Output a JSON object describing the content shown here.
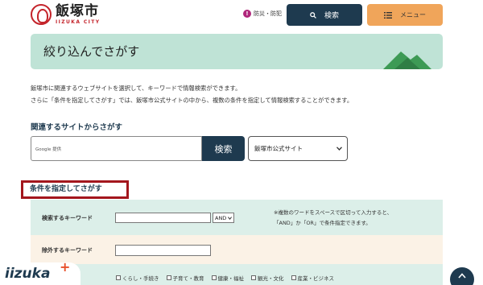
{
  "header": {
    "logo_title": "飯塚市",
    "logo_sub": "IIZUKA CITY",
    "disaster_icon": "!",
    "disaster_label": "防災・防犯",
    "search_icon": "search-icon",
    "search_label": "検索",
    "menu_icon": "hamburger-icon",
    "menu_label": "メニュー"
  },
  "banner": {
    "title": "絞り込んでさがす"
  },
  "description": {
    "line1": "飯塚市に関連するウェブサイトを選択して、キーワードで情報検索ができます。",
    "line2": "さらに「条件を指定してさがす」では、飯塚市公式サイトの中から、複数の条件を指定して情報検索することができます。"
  },
  "related": {
    "heading": "関連するサイトからさがす",
    "google_placeholder": "Google 提供",
    "search_button": "検索",
    "site_select_value": "飯塚市公式サイト"
  },
  "conditions": {
    "heading": "条件を指定してさがす",
    "keyword_label": "検索するキーワード",
    "keyword_value": "",
    "operator_value": "AND",
    "note_line1": "※複数のワードをスペースで区切って入力すると、",
    "note_line2": "「AND」か「OR」で条件指定できます。",
    "exclude_label": "除外するキーワード",
    "exclude_value": "",
    "categories": [
      "くらし・手続き",
      "子育て・教育",
      "健康・福祉",
      "観光・文化",
      "産業・ビジネス"
    ]
  },
  "footer": {
    "brand": "iizuka",
    "plus": "+",
    "top_icon": "chevron-up-icon"
  },
  "colors": {
    "navy": "#1e3a4f",
    "orange": "#f0a55a",
    "mint": "#bfe3d6",
    "red_border": "#a3161d"
  }
}
